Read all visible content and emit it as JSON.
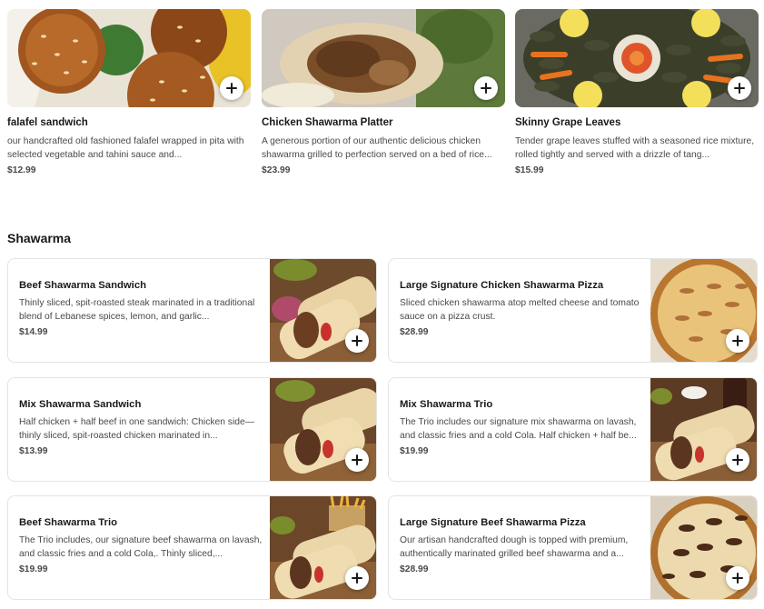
{
  "featured": [
    {
      "name": "falafel sandwich",
      "description": "our handcrafted old fashioned falafel wrapped in pita with selected vegetable and tahini sauce and...",
      "price": "$12.99",
      "image_icon": "falafel-photo"
    },
    {
      "name": "Chicken Shawarma Platter",
      "description": "A generous portion of our authentic delicious chicken shawarma grilled to perfection served on a bed of rice...",
      "price": "$23.99",
      "image_icon": "chicken-platter-photo"
    },
    {
      "name": "Skinny Grape Leaves",
      "description": "Tender grape leaves stuffed with a seasoned rice mixture, rolled tightly and served with a drizzle of tang...",
      "price": "$15.99",
      "image_icon": "grape-leaves-photo"
    }
  ],
  "section": {
    "title": "Shawarma",
    "items": [
      {
        "name": "Beef Shawarma Sandwich",
        "description": "Thinly sliced, spit-roasted steak marinated in a traditional blend of Lebanese spices, lemon, and garlic...",
        "price": "$14.99",
        "image_icon": "wrap-photo"
      },
      {
        "name": "Large Signature Chicken Shawarma Pizza",
        "description": "Sliced chicken shawarma atop melted cheese and tomato sauce on a pizza crust.",
        "price": "$28.99",
        "image_icon": "pizza-photo"
      },
      {
        "name": "Mix Shawarma Sandwich",
        "description": "Half chicken + half beef in one sandwich: Chicken side— thinly sliced, spit-roasted chicken marinated in...",
        "price": "$13.99",
        "image_icon": "wrap-photo"
      },
      {
        "name": "Mix Shawarma Trio",
        "description": "The Trio includes our signature mix shawarma on lavash, and classic fries and a cold Cola. Half chicken + half be...",
        "price": "$19.99",
        "image_icon": "trio-photo"
      },
      {
        "name": "Beef Shawarma Trio",
        "description": "The Trio includes, our signature beef shawarma on lavash, and classic fries and a cold Cola,. Thinly sliced,...",
        "price": "$19.99",
        "image_icon": "trio-fries-photo"
      },
      {
        "name": "Large Signature Beef Shawarma Pizza",
        "description": "Our artisan handcrafted dough is topped with premium, authentically marinated grilled beef shawarma and a...",
        "price": "$28.99",
        "image_icon": "pizza-photo"
      }
    ]
  },
  "add_button_icon": "plus-icon"
}
